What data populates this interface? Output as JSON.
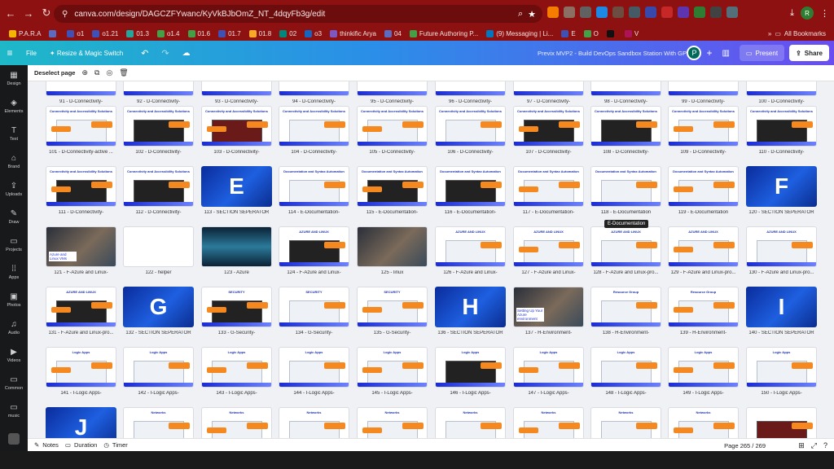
{
  "browser": {
    "url": "canva.com/design/DAGCZFYwanc/KyVkBJbOmZ_NT_4dqyFb3g/edit",
    "extensions": [
      "bolt-icon",
      "thumbtack-icon",
      "gdn-icon",
      "shield-icon",
      "puzzle-icon",
      "grid-icon",
      "calendar-icon",
      "2-badge",
      "gear-icon",
      "grammarly-icon",
      "play-icon",
      "puzzle-icon"
    ],
    "profile_initial": "R",
    "bookmarks": [
      {
        "label": "P.A.R.A",
        "color": "#f4b400"
      },
      {
        "label": "",
        "color": "#5c6bc0"
      },
      {
        "label": "o1",
        "color": "#3f51b5"
      },
      {
        "label": "o1.21",
        "color": "#3f51b5"
      },
      {
        "label": "01.3",
        "color": "#26a69a"
      },
      {
        "label": "o1.4",
        "color": "#43a047"
      },
      {
        "label": "01.6",
        "color": "#43a047"
      },
      {
        "label": "01.7",
        "color": "#3f51b5"
      },
      {
        "label": "01.8",
        "color": "#f9a825"
      },
      {
        "label": "02",
        "color": "#00897b"
      },
      {
        "label": "o3",
        "color": "#1565c0"
      },
      {
        "label": "thinkific Arya",
        "color": "#7e57c2"
      },
      {
        "label": "04",
        "color": "#5c6bc0"
      },
      {
        "label": "Future Authoring P...",
        "color": "#43a047"
      },
      {
        "label": "(9) Messaging | Li...",
        "color": "#0277bd"
      },
      {
        "label": "E",
        "color": "#3f51b5"
      },
      {
        "label": "O",
        "color": "#43a047"
      },
      {
        "label": "",
        "color": "#111"
      },
      {
        "label": "V",
        "color": "#ad1457"
      }
    ],
    "all_bookmarks_label": "All Bookmarks"
  },
  "canva_header": {
    "file_label": "File",
    "resize_label": "Resize & Magic Switch",
    "doc_title": "Previx MVP2 - Build DevOps Sandbox Station  With GPT v5",
    "user_initial": "P",
    "present_label": "Present",
    "share_label": "Share"
  },
  "sidebar": {
    "items": [
      {
        "label": "Design",
        "icon": "layout-icon"
      },
      {
        "label": "Elements",
        "icon": "shapes-icon"
      },
      {
        "label": "Text",
        "icon": "text-icon"
      },
      {
        "label": "Brand",
        "icon": "brand-icon"
      },
      {
        "label": "Uploads",
        "icon": "upload-icon"
      },
      {
        "label": "Draw",
        "icon": "pen-icon"
      },
      {
        "label": "Projects",
        "icon": "folder-icon"
      },
      {
        "label": "Apps",
        "icon": "apps-icon"
      },
      {
        "label": "Photos",
        "icon": "image-icon"
      },
      {
        "label": "Audio",
        "icon": "music-icon"
      },
      {
        "label": "Videos",
        "icon": "video-icon"
      },
      {
        "label": "Common",
        "icon": "folder-icon"
      },
      {
        "label": "music",
        "icon": "folder-icon"
      }
    ]
  },
  "subbar": {
    "deselect_label": "Deselect page"
  },
  "tooltip": "E-Documentation",
  "pages": [
    {
      "cap": "91 - D-Connectivity-",
      "k": "top"
    },
    {
      "cap": "92 - D-Connectivity-",
      "k": "top"
    },
    {
      "cap": "93 - D-Connectivity-",
      "k": "top"
    },
    {
      "cap": "94 - D-Connectivity-",
      "k": "top"
    },
    {
      "cap": "95 - D-Connectivity-",
      "k": "top"
    },
    {
      "cap": "96 - D-Connectivity-",
      "k": "top"
    },
    {
      "cap": "97 - D-Connectivity-",
      "k": "top"
    },
    {
      "cap": "98 - D-Connectivity-",
      "k": "top"
    },
    {
      "cap": "99 - D-Connectivity-",
      "k": "top"
    },
    {
      "cap": "100 - D-Connectivity-",
      "k": "top"
    },
    {
      "cap": "101 - D-Connectivity-active ...",
      "k": "slide",
      "hd": "Connectivity and Accessibility Solutions",
      "img": "light"
    },
    {
      "cap": "102 - D-Connectivity-",
      "k": "slide",
      "hd": "Connectivity and Accessibility Solutions",
      "img": "dark"
    },
    {
      "cap": "103 - D-Connectivity-",
      "k": "slide",
      "hd": "Connectivity and Accessibility Solutions",
      "img": "red"
    },
    {
      "cap": "104 - D-Connectivity-",
      "k": "slide",
      "hd": "Connectivity and Accessibility Solutions",
      "img": "light"
    },
    {
      "cap": "105 - D-Connectivity-",
      "k": "slide",
      "hd": "Connectivity and Accessibility Solutions",
      "img": "light"
    },
    {
      "cap": "106 - D-Connectivity-",
      "k": "slide",
      "hd": "Connectivity and Accessibility Solutions",
      "img": "light"
    },
    {
      "cap": "107 - D-Connectivity-",
      "k": "slide",
      "hd": "Connectivity and Accessibility Solutions",
      "img": "dark"
    },
    {
      "cap": "108 - D-Connectivity-",
      "k": "slide",
      "hd": "Connectivity and Accessibility Solutions",
      "img": "dark"
    },
    {
      "cap": "109 - D-Connectivity-",
      "k": "slide",
      "hd": "Connectivity and Accessibility Solutions",
      "img": "light"
    },
    {
      "cap": "110 - D-Connectivity-",
      "k": "slide",
      "hd": "Connectivity and Accessibility Solutions",
      "img": "dark"
    },
    {
      "cap": "111 - D-Connectivity-",
      "k": "slide",
      "hd": "Connectivity and Accessibility Solutions",
      "img": "dark"
    },
    {
      "cap": "112 - D-Connectivity-",
      "k": "slide",
      "hd": "Connectivity and Accessibility Solutions",
      "img": "dark"
    },
    {
      "cap": "113 - SECTION SEPERATOR",
      "k": "sep",
      "letter": "E"
    },
    {
      "cap": "114 - E-Documentation-",
      "k": "slide",
      "hd": "Documentation and Syntax Automation",
      "img": "light"
    },
    {
      "cap": "115 - E-Documentation-",
      "k": "slide",
      "hd": "Documentation and Syntax Automation",
      "img": "dark"
    },
    {
      "cap": "116 - E-Documentation-",
      "k": "slide",
      "hd": "Documentation and Syntax Automation",
      "img": "dark"
    },
    {
      "cap": "117 - E-Documentation-",
      "k": "slide",
      "hd": "Documentation and Syntax Automation",
      "img": "light"
    },
    {
      "cap": "118 - E-Documentation",
      "k": "slide",
      "hd": "Documentation and Syntax Automation",
      "img": "light"
    },
    {
      "cap": "119 - E-Documentation",
      "k": "slide",
      "hd": "Documentation and Syntax Automation",
      "img": "light"
    },
    {
      "cap": "120 - SECTION SEPERATOR",
      "k": "sep",
      "letter": "F"
    },
    {
      "cap": "121 - F-Azure and Linux-",
      "k": "photo",
      "hd": "Azure and Linux VMs"
    },
    {
      "cap": "122 - helper",
      "k": "blank"
    },
    {
      "cap": "123 - Azure",
      "k": "dc"
    },
    {
      "cap": "124 - F-Azure and Linux-",
      "k": "slide",
      "hd": "AZURE AND LINUX",
      "img": "dark"
    },
    {
      "cap": "125 - linux",
      "k": "photo",
      "hd": ""
    },
    {
      "cap": "126 - F-Azure and Linux-",
      "k": "slide",
      "hd": "AZURE AND LINUX",
      "img": "light"
    },
    {
      "cap": "127 - F-Azure and Linux-",
      "k": "slide",
      "hd": "AZURE AND LINUX",
      "img": "light"
    },
    {
      "cap": "128 - F-Azure and Linux-pro...",
      "k": "slide",
      "hd": "AZURE AND LINUX",
      "img": "light"
    },
    {
      "cap": "129 - F-Azure and Linux-pro...",
      "k": "slide",
      "hd": "AZURE AND LINUX",
      "img": "light"
    },
    {
      "cap": "130 - F-Azure and Linux-pro...",
      "k": "slide",
      "hd": "AZURE AND LINUX",
      "img": "light"
    },
    {
      "cap": "131 - F-Azure and Linux-pro...",
      "k": "slide",
      "hd": "AZURE AND LINUX",
      "img": "dark"
    },
    {
      "cap": "132 - SECTION SEPERATOR",
      "k": "sep",
      "letter": "G"
    },
    {
      "cap": "133 - G-Security-",
      "k": "slide",
      "hd": "SECURITY",
      "img": "dark"
    },
    {
      "cap": "134 - G-Security-",
      "k": "slide",
      "hd": "SECURITY",
      "img": "light"
    },
    {
      "cap": "135 - G-Security-",
      "k": "slide",
      "hd": "SECURITY",
      "img": "light"
    },
    {
      "cap": "136 - SECTION SEPERATOR",
      "k": "sep",
      "letter": "H"
    },
    {
      "cap": "137 - H-Environment-",
      "k": "photo",
      "hd": "Setting Up Your Azure environment"
    },
    {
      "cap": "138 - H-Environment-",
      "k": "slide",
      "hd": "Resource Group",
      "img": "light"
    },
    {
      "cap": "139 - H-Environment-",
      "k": "slide",
      "hd": "Resource Group",
      "img": "light"
    },
    {
      "cap": "140 - SECTION SEPERATOR",
      "k": "sep",
      "letter": "I"
    },
    {
      "cap": "141 - I-Logic Apps-",
      "k": "slide",
      "hd": "Logic Apps",
      "img": "light"
    },
    {
      "cap": "142 - I-Logic Apps-",
      "k": "slide",
      "hd": "Logic Apps",
      "img": "light"
    },
    {
      "cap": "143 - I-Logic Apps-",
      "k": "slide",
      "hd": "Logic Apps",
      "img": "light"
    },
    {
      "cap": "144 - I-Logic Apps-",
      "k": "slide",
      "hd": "Logic Apps",
      "img": "light"
    },
    {
      "cap": "145 - I-Logic Apps-",
      "k": "slide",
      "hd": "Logic Apps",
      "img": "light"
    },
    {
      "cap": "146 - I-Logic Apps-",
      "k": "slide",
      "hd": "Logic Apps",
      "img": "dark"
    },
    {
      "cap": "147 - I-Logic Apps-",
      "k": "slide",
      "hd": "Logic Apps",
      "img": "light"
    },
    {
      "cap": "148 - I-Logic Apps-",
      "k": "slide",
      "hd": "Logic Apps",
      "img": "light"
    },
    {
      "cap": "149 - I-Logic Apps-",
      "k": "slide",
      "hd": "Logic Apps",
      "img": "light"
    },
    {
      "cap": "150 - I-Logic Apps-",
      "k": "slide",
      "hd": "Logic Apps",
      "img": "light"
    },
    {
      "cap": "",
      "k": "sep",
      "letter": "J"
    },
    {
      "cap": "",
      "k": "slide",
      "hd": "Networks",
      "img": "light"
    },
    {
      "cap": "",
      "k": "slide",
      "hd": "Networks",
      "img": "light"
    },
    {
      "cap": "",
      "k": "slide",
      "hd": "Networks",
      "img": "light"
    },
    {
      "cap": "",
      "k": "slide",
      "hd": "Networks",
      "img": "light"
    },
    {
      "cap": "",
      "k": "slide",
      "hd": "Networks",
      "img": "light"
    },
    {
      "cap": "",
      "k": "slide",
      "hd": "Networks",
      "img": "light"
    },
    {
      "cap": "",
      "k": "slide",
      "hd": "Networks",
      "img": "light"
    },
    {
      "cap": "",
      "k": "slide",
      "hd": "Networks",
      "img": "light"
    },
    {
      "cap": "",
      "k": "slide",
      "hd": "",
      "img": "red"
    }
  ],
  "bottom": {
    "notes_label": "Notes",
    "duration_label": "Duration",
    "timer_label": "Timer",
    "page_count": "Page 265 / 269"
  }
}
